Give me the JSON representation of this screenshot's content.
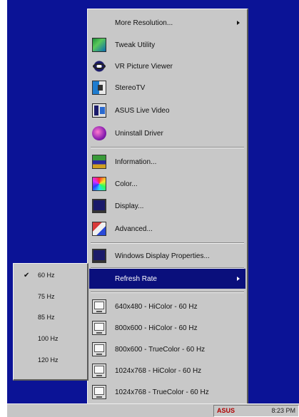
{
  "main_menu": {
    "top_item": {
      "label": "More Resolution..."
    },
    "apps": [
      {
        "label": "Tweak Utility",
        "icon": "tweak-utility-icon"
      },
      {
        "label": "VR Picture Viewer",
        "icon": "vr-glasses-icon"
      },
      {
        "label": "StereoTV",
        "icon": "stereo-tv-icon"
      },
      {
        "label": "ASUS Live Video",
        "icon": "live-video-icon"
      },
      {
        "label": "Uninstall Driver",
        "icon": "uninstall-icon"
      }
    ],
    "settings": [
      {
        "label": "Information...",
        "icon": "information-icon"
      },
      {
        "label": "Color...",
        "icon": "color-icon"
      },
      {
        "label": "Display...",
        "icon": "display-icon"
      },
      {
        "label": "Advanced...",
        "icon": "advanced-icon"
      }
    ],
    "windows_display": {
      "label": "Windows Display Properties..."
    },
    "refresh_rate": {
      "label": "Refresh Rate"
    },
    "resolutions": [
      {
        "label": "640x480 - HiColor - 60 Hz"
      },
      {
        "label": "800x600 - HiColor - 60 Hz"
      },
      {
        "label": "800x600 - TrueColor - 60 Hz"
      },
      {
        "label": "1024x768 - HiColor - 60 Hz"
      },
      {
        "label": "1024x768 - TrueColor - 60 Hz"
      }
    ]
  },
  "refresh_submenu": {
    "checked_index": 0,
    "items": [
      {
        "label": "60 Hz"
      },
      {
        "label": "75 Hz"
      },
      {
        "label": "85 Hz"
      },
      {
        "label": "100 Hz"
      },
      {
        "label": "120 Hz"
      }
    ]
  },
  "taskbar": {
    "tray_icon_text": "ASUS",
    "clock": "8:23 PM"
  },
  "colors": {
    "desktop": "#0b1396",
    "menu_bg": "#c8c8c8",
    "highlight": "#0a0f7c"
  }
}
